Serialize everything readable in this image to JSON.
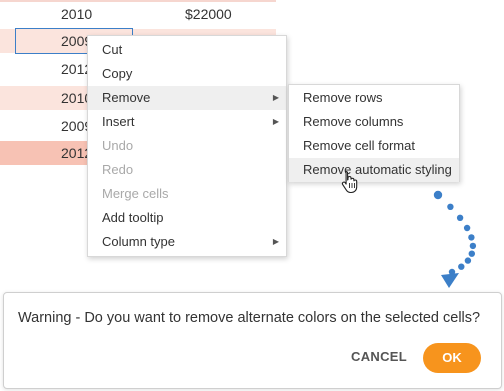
{
  "sheet": {
    "rows": [
      {
        "year": "2010",
        "amount": "$22000",
        "bg": "#ffffff"
      },
      {
        "year": "2009",
        "amount": "",
        "bg": "#fbe4dd"
      },
      {
        "year": "2012",
        "amount": "",
        "bg": "#ffffff"
      },
      {
        "year": "2010",
        "amount": "",
        "bg": "#fbe4dd"
      },
      {
        "year": "2009",
        "amount": "",
        "bg": "#ffffff"
      },
      {
        "year": "2012",
        "amount": "",
        "bg": "#f7c2b4"
      }
    ]
  },
  "context_menu": {
    "items": [
      {
        "label": "Cut",
        "disabled": false,
        "submenu": false
      },
      {
        "label": "Copy",
        "disabled": false,
        "submenu": false
      },
      {
        "label": "Remove",
        "disabled": false,
        "submenu": true,
        "active": true
      },
      {
        "label": "Insert",
        "disabled": false,
        "submenu": true
      },
      {
        "label": "Undo",
        "disabled": true,
        "submenu": false
      },
      {
        "label": "Redo",
        "disabled": true,
        "submenu": false
      },
      {
        "label": "Merge cells",
        "disabled": true,
        "submenu": false
      },
      {
        "label": "Add tooltip",
        "disabled": false,
        "submenu": false
      },
      {
        "label": "Column type",
        "disabled": false,
        "submenu": true
      }
    ]
  },
  "remove_submenu": {
    "items": [
      {
        "label": "Remove rows"
      },
      {
        "label": "Remove columns"
      },
      {
        "label": "Remove cell format"
      },
      {
        "label": "Remove automatic styling",
        "hover": true
      }
    ]
  },
  "dialog": {
    "message": "Warning - Do you want to remove alternate colors on the selected cells?",
    "cancel_label": "CANCEL",
    "ok_label": "OK"
  },
  "colors": {
    "accent_ok": "#f7941d",
    "dots": "#3c7fc8",
    "selection": "#3c7fc8"
  }
}
